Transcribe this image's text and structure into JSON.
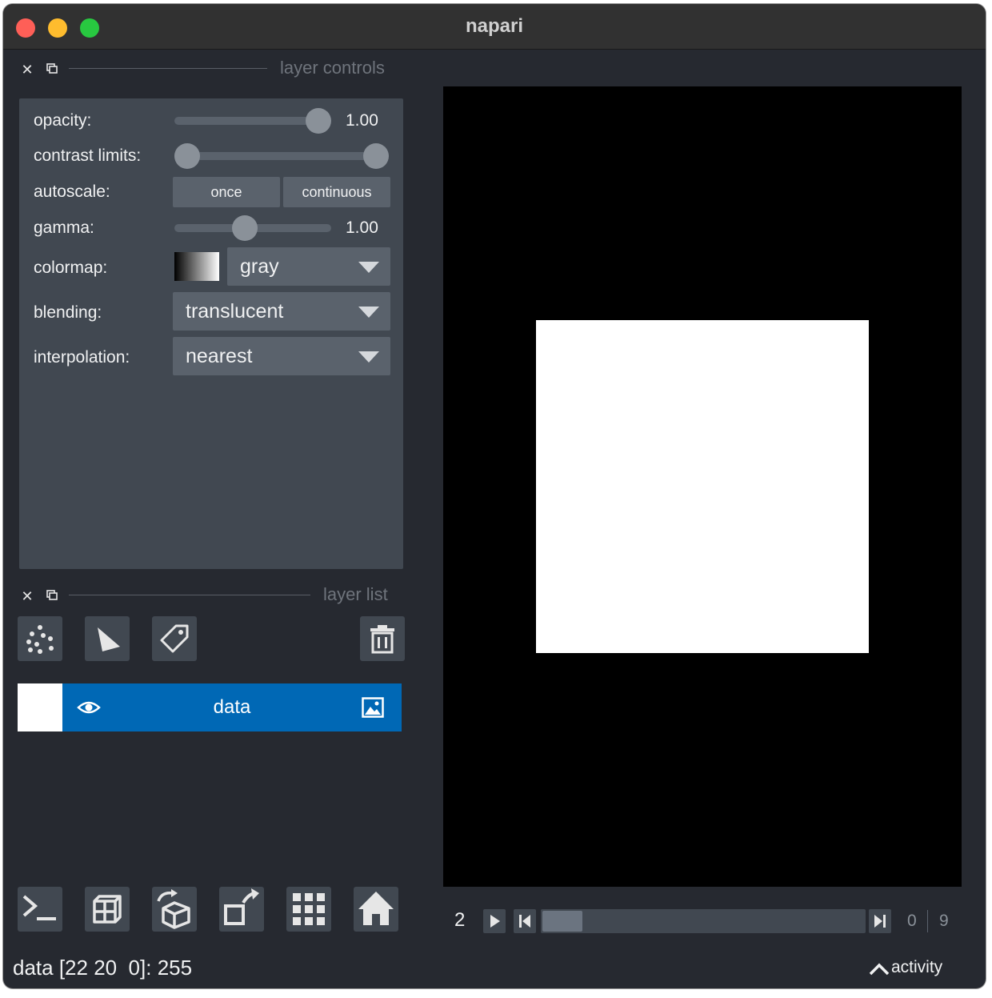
{
  "window": {
    "title": "napari"
  },
  "layer_controls": {
    "title": "layer controls",
    "opacity": {
      "label": "opacity:",
      "value": "1.00",
      "level": 1.0
    },
    "contrast_limits": {
      "label": "contrast limits:",
      "low": 0.0,
      "high": 1.0
    },
    "autoscale": {
      "label": "autoscale:",
      "once": "once",
      "continuous": "continuous"
    },
    "gamma": {
      "label": "gamma:",
      "value": "1.00",
      "level": 0.45
    },
    "colormap": {
      "label": "colormap:",
      "value": "gray"
    },
    "blending": {
      "label": "blending:",
      "value": "translucent"
    },
    "interpolation": {
      "label": "interpolation:",
      "value": "nearest"
    }
  },
  "layer_list": {
    "title": "layer list",
    "tools": [
      "points-icon",
      "shapes-icon",
      "labels-icon"
    ],
    "delete_icon": "trash-icon",
    "layers": [
      {
        "name": "data",
        "visible": true,
        "type_icon": "image-icon"
      }
    ]
  },
  "viewer_buttons": [
    "console-icon",
    "ndisplay-icon",
    "roll-icon",
    "transpose-icon",
    "grid-icon",
    "home-icon"
  ],
  "dims_slider": {
    "current": "2",
    "min": "0",
    "max": "9",
    "level": 0.0
  },
  "status": {
    "text": "data [22 20  0]: 255",
    "activity": "activity"
  },
  "colors": {
    "background": "#262930",
    "panel": "#414851",
    "highlight": "#0068b5",
    "text": "#f0f1f2"
  }
}
